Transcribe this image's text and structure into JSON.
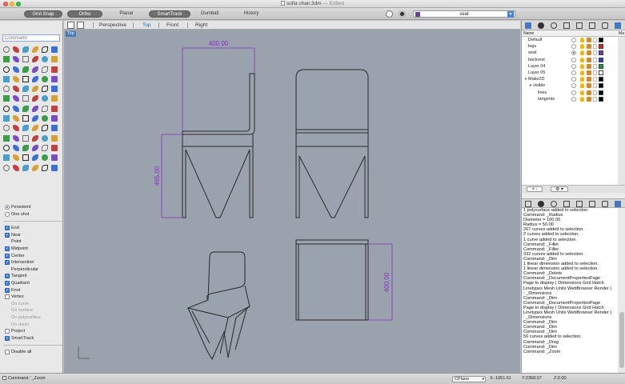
{
  "window": {
    "title": "sofia chair.3dm",
    "edited": "— Edited"
  },
  "toolbar": {
    "grid_snap": "Grid Snap",
    "ortho": "Ortho",
    "planar": "Planar",
    "smarttrack": "SmartTrack",
    "gumball": "Gumball",
    "history": "History",
    "current_layer": "seat"
  },
  "left": {
    "command_placeholder": "Command",
    "osnaps": [
      {
        "label": "Persistent",
        "kind": "radio",
        "checked": true,
        "dim": false
      },
      {
        "label": "One shot",
        "kind": "radio",
        "checked": false,
        "dim": false
      },
      {
        "label": "End",
        "kind": "check",
        "checked": true,
        "dim": false
      },
      {
        "label": "Near",
        "kind": "check",
        "checked": true,
        "dim": false
      },
      {
        "label": "Point",
        "kind": "none",
        "checked": false,
        "dim": false
      },
      {
        "label": "Midpoint",
        "kind": "check",
        "checked": true,
        "dim": false
      },
      {
        "label": "Center",
        "kind": "check",
        "checked": true,
        "dim": false
      },
      {
        "label": "Intersection",
        "kind": "check",
        "checked": true,
        "dim": false
      },
      {
        "label": "Perpendicular",
        "kind": "none",
        "checked": false,
        "dim": false
      },
      {
        "label": "Tangent",
        "kind": "check",
        "checked": true,
        "dim": false
      },
      {
        "label": "Quadrant",
        "kind": "check",
        "checked": true,
        "dim": false
      },
      {
        "label": "Knot",
        "kind": "check",
        "checked": true,
        "dim": false
      },
      {
        "label": "Vertex",
        "kind": "check",
        "checked": false,
        "dim": false
      },
      {
        "label": "On curve",
        "kind": "none",
        "checked": false,
        "dim": true
      },
      {
        "label": "On surface",
        "kind": "none",
        "checked": false,
        "dim": true
      },
      {
        "label": "On polysurface",
        "kind": "none",
        "checked": false,
        "dim": true
      },
      {
        "label": "On mesh",
        "kind": "none",
        "checked": false,
        "dim": true
      },
      {
        "label": "Project",
        "kind": "check",
        "checked": false,
        "dim": false
      },
      {
        "label": "SmartTrack",
        "kind": "check",
        "checked": true,
        "dim": false
      }
    ],
    "disable_all": "Disable all"
  },
  "viewport_tabs": {
    "perspective": "Perspective",
    "top": "Top",
    "front": "Front",
    "right": "Right"
  },
  "viewport": {
    "label": "Top",
    "dim_top_width": "400.00",
    "dim_left_height": "465.00",
    "dim_right_height": "400.00",
    "line_color": "#2a2a2a",
    "dim_color": "#8a2fc9"
  },
  "layers": {
    "header_name": "Name",
    "header_mat": "Ma",
    "rows": [
      {
        "name": "Default",
        "indent": 0,
        "current": false,
        "color": "#000000"
      },
      {
        "name": "legs",
        "indent": 0,
        "current": false,
        "color": "#e01b1b"
      },
      {
        "name": "seat",
        "indent": 0,
        "current": true,
        "color": "#7a2ec4"
      },
      {
        "name": "backrest",
        "indent": 0,
        "current": false,
        "color": "#2040d0"
      },
      {
        "name": "Layer 04",
        "indent": 0,
        "current": false,
        "color": "#1a9a2a"
      },
      {
        "name": "Layer 05",
        "indent": 0,
        "current": false,
        "color": "#ffffff"
      },
      {
        "name": "Make2D",
        "indent": 0,
        "current": false,
        "color": "#000000",
        "expanded": true
      },
      {
        "name": "visible",
        "indent": 1,
        "current": false,
        "color": "#000000",
        "expanded": true
      },
      {
        "name": "lines",
        "indent": 2,
        "current": false,
        "color": "#000000"
      },
      {
        "name": "tangents",
        "indent": 2,
        "current": false,
        "color": "#000000"
      }
    ],
    "add_btn": "+",
    "remove_btn": "-",
    "gear_btn": "⚙ ▾"
  },
  "history_lines": [
    "1 polysurface added to selection.",
    "Command: _Radius",
    "Diameter = 100.00",
    "Radius = 50.00",
    "267 curves added to selection.",
    "2 curves added to selection.",
    "1 curve added to selection.",
    "Command: _Fillet",
    "Command: _Fillet",
    "332 curves added to selection.",
    "Command: _Dim",
    "1 linear dimension added to selection.",
    "1 linear dimension added to selection.",
    "Command: _Delete",
    "Command: _DocumentPropertiesPage",
    "Page to display ( Dimensions Grid Hatch",
    "Linetypes Mesh Units WebBrowser Render )",
    ": _Dimensions",
    "Command: _Dim",
    "Command: _DocumentPropertiesPage",
    "Page to display ( Dimensions Grid Hatch",
    "Linetypes Mesh Units WebBrowser Render )",
    ": _Dimensions",
    "Command: _Dim",
    "Command: _Dim",
    "Command: _Dim",
    "56 curves added to selection.",
    "Command: _Drag",
    "Command: _Dim",
    "Command: _Zoom"
  ],
  "status": {
    "command": "Command: '_Zoom",
    "cplane": "CPlane",
    "x": "X:-1051.61",
    "y": "Y:2368.07",
    "z": "Z:0.00"
  }
}
